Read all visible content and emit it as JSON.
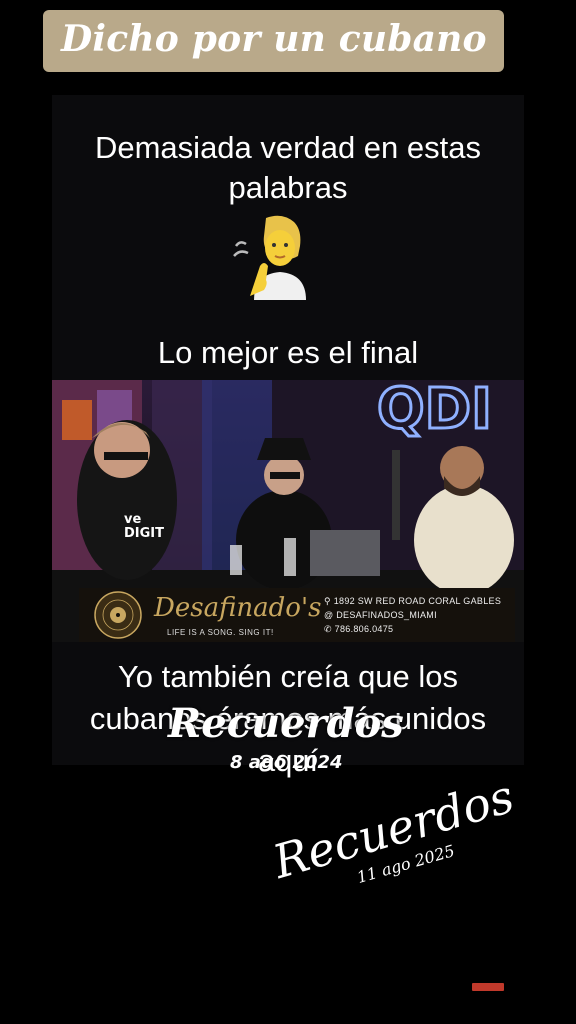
{
  "header": {
    "title": "Dicho por un cubano"
  },
  "captions": {
    "line1": "Demasiada verdad en estas",
    "line2": "palabras",
    "emoji": "person-with-hand-to-ear-icon",
    "line3": "Lo mejor es el final",
    "line4": "Yo también creía que los",
    "line5": "cubanos éramos más unidos",
    "line6": "aquí"
  },
  "video": {
    "logo_text": "QDI",
    "shirt_text": "ve\nDIGIT",
    "banner": {
      "brand": "Desafinado's",
      "slogan": "LIFE IS A SONG. SING IT!",
      "address": "1892 SW RED ROAD CORAL GABLES",
      "handle": "DESAFINADOS_MIAMI",
      "phone": "786.806.0475"
    }
  },
  "overlay": {
    "recuerdos_1": "Recuerdos",
    "date_1": "8 ago 2024",
    "recuerdos_2": "Recuerdos",
    "date_2": "11 ago 2025"
  },
  "colors": {
    "banner_bg": "#b9a98a",
    "brand_gold": "#c8a760",
    "background": "#000000"
  }
}
